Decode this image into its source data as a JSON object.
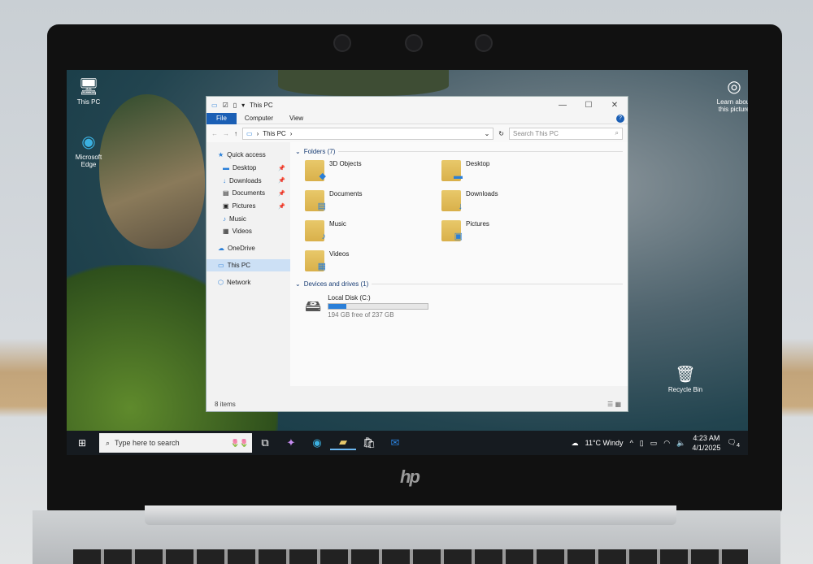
{
  "desktop": {
    "icons": [
      {
        "label": "This PC",
        "icon": "computer-icon"
      },
      {
        "label": "Microsoft Edge",
        "icon": "edge-icon"
      },
      {
        "label": "Recycle Bin",
        "icon": "recycle-bin-icon"
      },
      {
        "label": "Learn about this picture",
        "icon": "camera-icon"
      }
    ]
  },
  "explorer": {
    "title": "This PC",
    "controls": {
      "minimize": "—",
      "maximize": "☐",
      "close": "✕"
    },
    "ribbon": {
      "tabs": [
        "File",
        "Computer",
        "View"
      ],
      "help": "?"
    },
    "address": {
      "path": "This PC",
      "search_placeholder": "Search This PC"
    },
    "nav": [
      {
        "label": "Quick access",
        "icon": "★"
      },
      {
        "label": "Desktop",
        "icon": "▬",
        "pinned": true
      },
      {
        "label": "Downloads",
        "icon": "↓",
        "pinned": true
      },
      {
        "label": "Documents",
        "icon": "▤",
        "pinned": true
      },
      {
        "label": "Pictures",
        "icon": "▣",
        "pinned": true
      },
      {
        "label": "Music",
        "icon": "♪"
      },
      {
        "label": "Videos",
        "icon": "▦"
      },
      {
        "label": "OneDrive",
        "icon": "☁"
      },
      {
        "label": "This PC",
        "icon": "▭"
      },
      {
        "label": "Network",
        "icon": "⬡"
      }
    ],
    "folders_header": "Folders (7)",
    "folders": [
      {
        "name": "3D Objects",
        "badge": "◆"
      },
      {
        "name": "Desktop",
        "badge": "▬"
      },
      {
        "name": "Documents",
        "badge": "▤"
      },
      {
        "name": "Downloads",
        "badge": "↓"
      },
      {
        "name": "Music",
        "badge": "♪"
      },
      {
        "name": "Pictures",
        "badge": "▣"
      },
      {
        "name": "Videos",
        "badge": "▦"
      }
    ],
    "drives_header": "Devices and drives (1)",
    "drive": {
      "name": "Local Disk (C:)",
      "free": "194 GB free of 237 GB",
      "used_fraction": 0.18
    },
    "status": "8 items"
  },
  "taskbar": {
    "search_placeholder": "Type here to search",
    "weather": "11°C  Windy",
    "time": "4:23 AM",
    "date": "4/1/2025",
    "notifications": "4"
  },
  "brand": "hp"
}
